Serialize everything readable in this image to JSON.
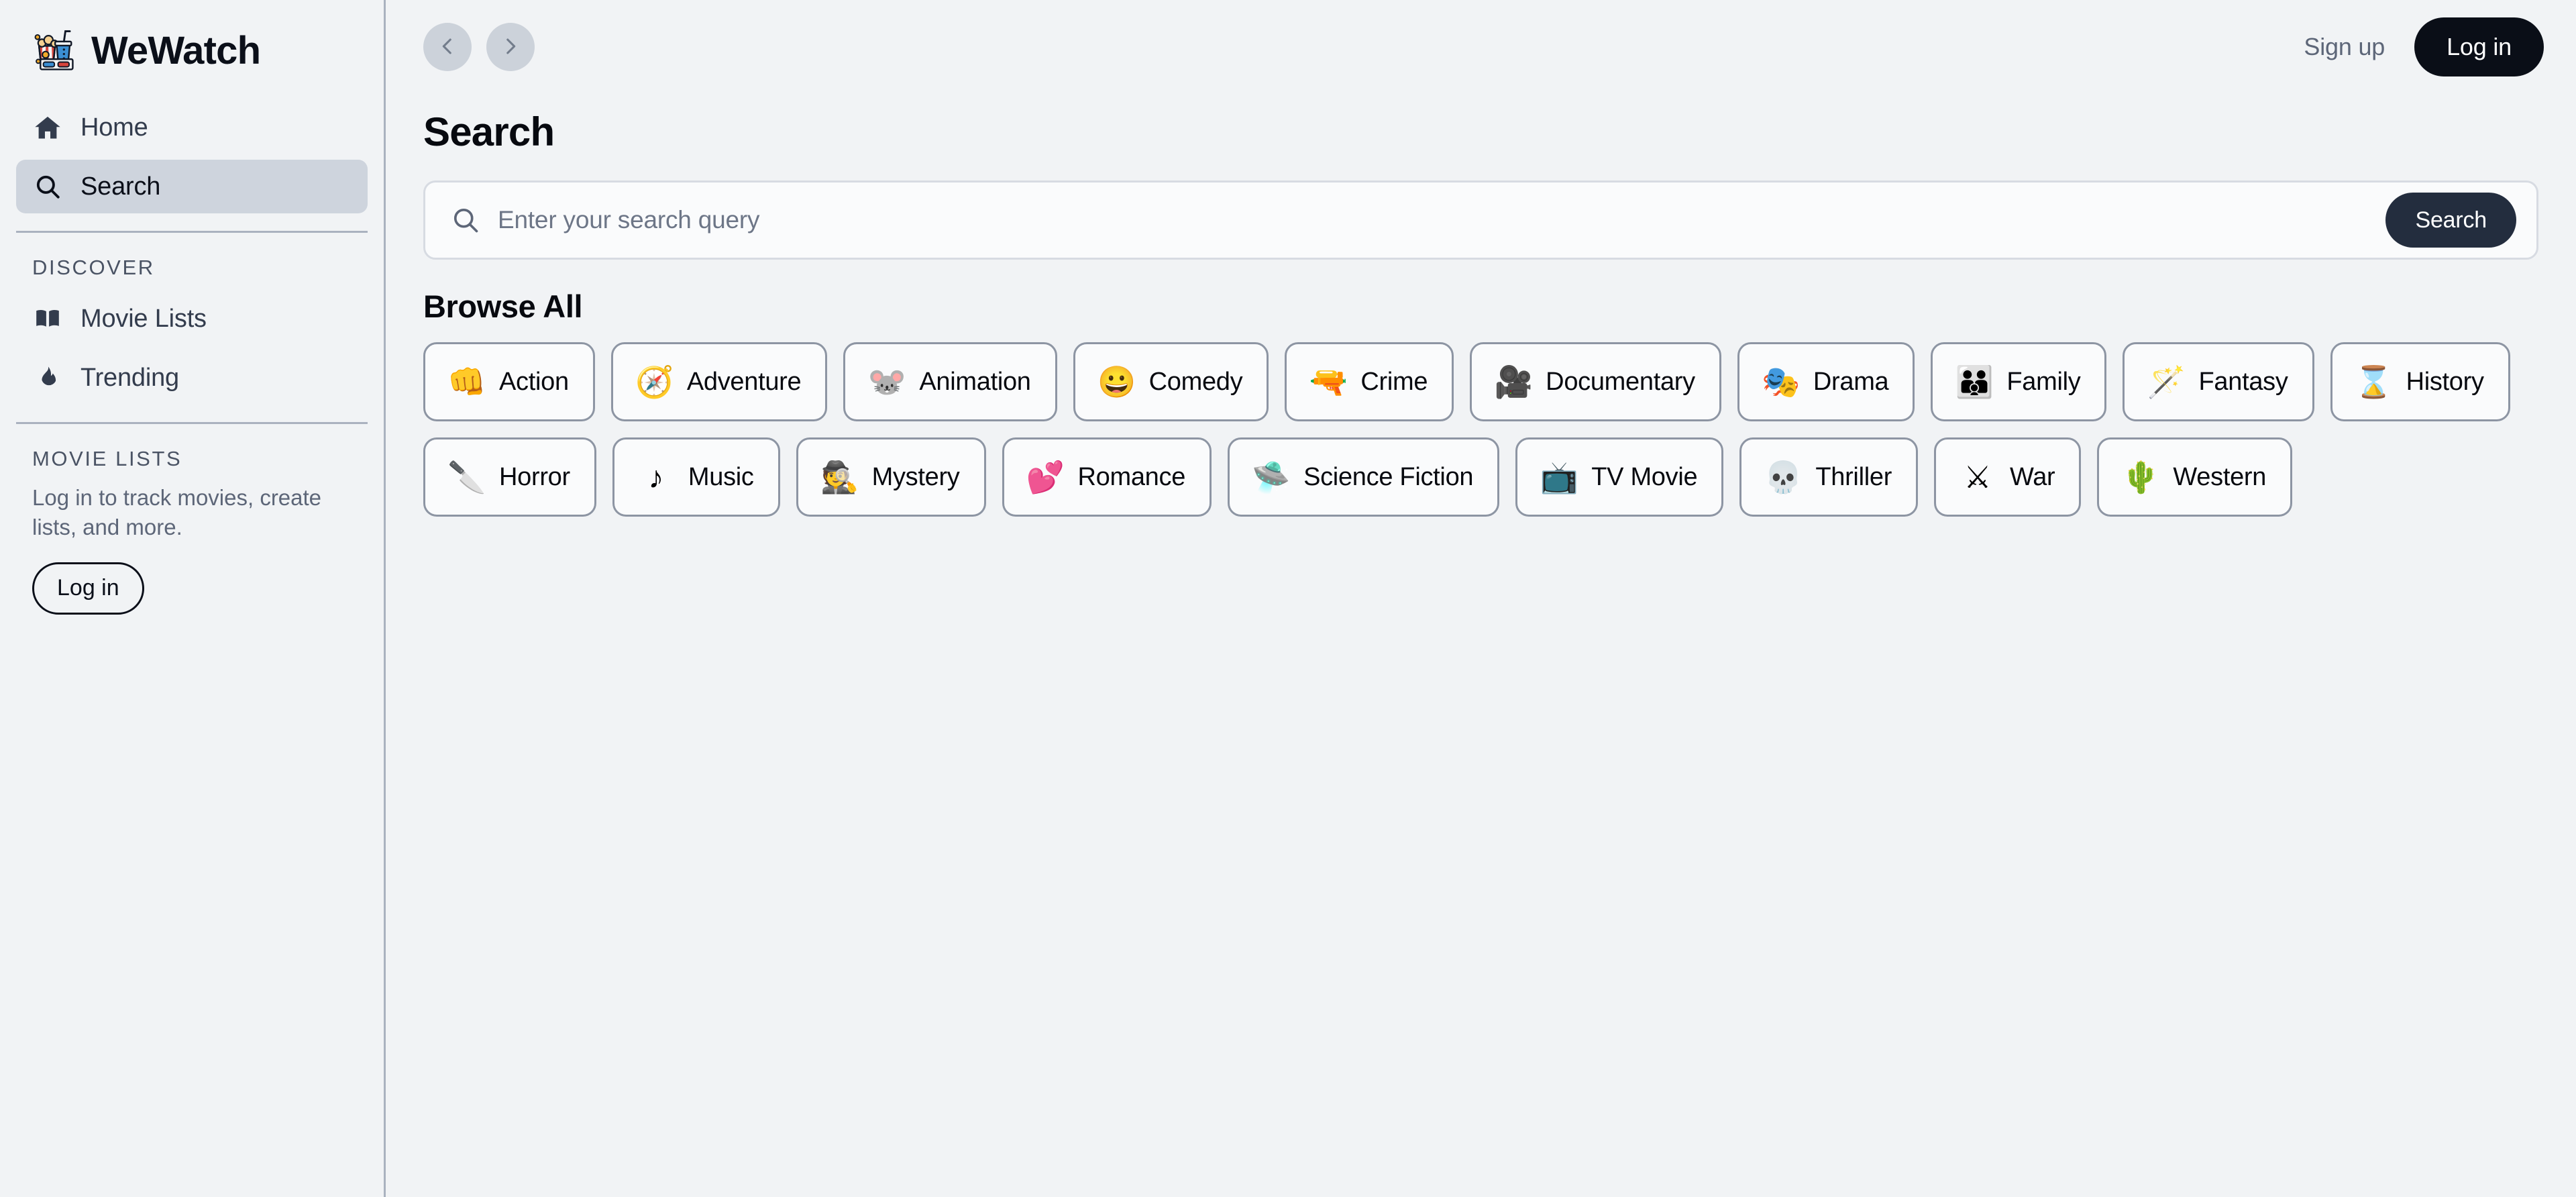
{
  "brand": {
    "logo_icon": "popcorn-drink-3d-glasses-emoji",
    "logo_glyph": "🍿",
    "name": "WeWatch"
  },
  "sidebar": {
    "primary_items": [
      {
        "label": "Home",
        "icon": "home-icon",
        "active": false
      },
      {
        "label": "Search",
        "icon": "search-icon",
        "active": true
      }
    ],
    "discover": {
      "title": "DISCOVER",
      "items": [
        {
          "label": "Movie Lists",
          "icon": "book-icon"
        },
        {
          "label": "Trending",
          "icon": "flame-icon"
        }
      ]
    },
    "movie_lists": {
      "title": "MOVIE LISTS",
      "note": "Log in to track movies, create lists, and more.",
      "login_label": "Log in"
    }
  },
  "topbar": {
    "back_icon": "chevron-left-icon",
    "forward_icon": "chevron-right-icon",
    "sign_up_label": "Sign up",
    "log_in_label": "Log in"
  },
  "main": {
    "page_title": "Search",
    "search": {
      "icon": "search-icon",
      "placeholder": "Enter your search query",
      "value": "",
      "submit_label": "Search"
    },
    "browse": {
      "title": "Browse All",
      "genres": [
        {
          "label": "Action",
          "icon": "fist-icon",
          "glyph": "👊"
        },
        {
          "label": "Adventure",
          "icon": "compass-icon",
          "glyph": "🧭"
        },
        {
          "label": "Animation",
          "icon": "mouse-ears-icon",
          "glyph": "🐭"
        },
        {
          "label": "Comedy",
          "icon": "comedy-mask-icon",
          "glyph": "😀"
        },
        {
          "label": "Crime",
          "icon": "pistol-icon",
          "glyph": "🔫"
        },
        {
          "label": "Documentary",
          "icon": "film-camera-icon",
          "glyph": "🎥"
        },
        {
          "label": "Drama",
          "icon": "drama-mask-icon",
          "glyph": "🎭"
        },
        {
          "label": "Family",
          "icon": "family-icon",
          "glyph": "👪"
        },
        {
          "label": "Fantasy",
          "icon": "magic-wand-icon",
          "glyph": "🪄"
        },
        {
          "label": "History",
          "icon": "hourglass-icon",
          "glyph": "⌛"
        },
        {
          "label": "Horror",
          "icon": "knife-icon",
          "glyph": "🔪"
        },
        {
          "label": "Music",
          "icon": "music-note-icon",
          "glyph": "♪"
        },
        {
          "label": "Mystery",
          "icon": "detective-icon",
          "glyph": "🕵"
        },
        {
          "label": "Romance",
          "icon": "two-hearts-icon",
          "glyph": "💕"
        },
        {
          "label": "Science Fiction",
          "icon": "flying-saucer-icon",
          "glyph": "🛸"
        },
        {
          "label": "TV Movie",
          "icon": "tv-play-icon",
          "glyph": "📺"
        },
        {
          "label": "Thriller",
          "icon": "skull-icon",
          "glyph": "💀"
        },
        {
          "label": "War",
          "icon": "crossed-swords-icon",
          "glyph": "⚔"
        },
        {
          "label": "Western",
          "icon": "cactus-icon",
          "glyph": "🌵"
        }
      ]
    }
  },
  "colors": {
    "page_background": "#f1f3f5",
    "sidebar_border": "#aab2bf",
    "active_nav_background": "#ced4dd",
    "accent_dark": "#0a0e17",
    "search_button": "#232d3e",
    "chip_border": "#8d95a3",
    "muted_text": "#5d6678"
  }
}
